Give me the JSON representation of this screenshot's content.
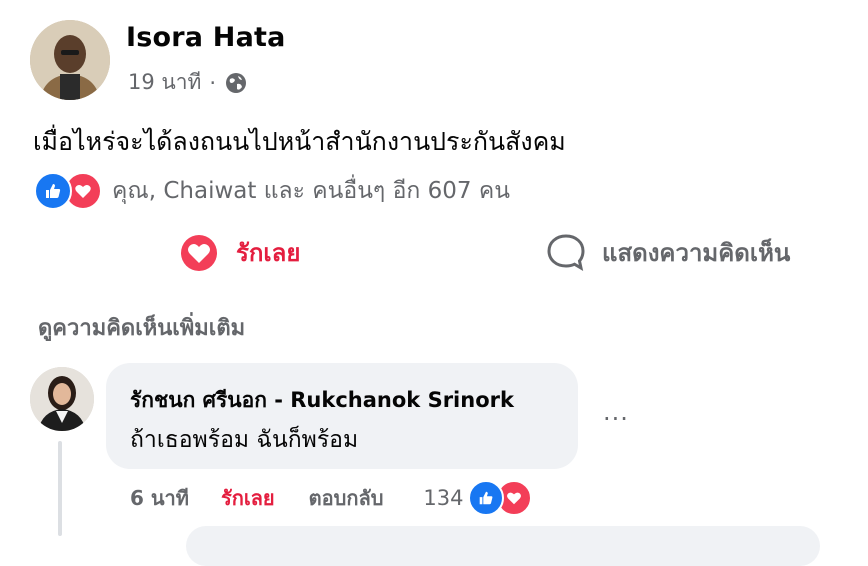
{
  "post": {
    "author": "Isora Hata",
    "time": "19 นาที",
    "separator": "·",
    "text": "เมื่อไหร่จะได้ลงถนนไปหน้าสำนักงานประกันสังคม",
    "reactions_text": "คุณ, Chaiwat และ คนอื่นๆ อีก 607 คน",
    "icons": {
      "privacy": "globe-icon",
      "like": "like-icon",
      "love": "love-icon",
      "comment": "comment-icon"
    }
  },
  "actions": {
    "love_label": "รักเลย",
    "comment_label": "แสดงความคิดเห็น"
  },
  "comments_section": {
    "more_label": "ดูความคิดเห็นเพิ่มเติม"
  },
  "comment": {
    "author": "รักชนก ศรีนอก - Rukchanok Srinork",
    "text": "ถ้าเธอพร้อม ฉันก็พร้อม",
    "more": "···",
    "time": "6 นาที",
    "love_label": "รักเลย",
    "reply_label": "ตอบกลับ",
    "reaction_count": "134"
  },
  "colors": {
    "like": "#1877f2",
    "love": "#f33e58",
    "love_text": "#e41e3f",
    "secondary_text": "#65676b",
    "bubble": "#f0f2f5"
  }
}
